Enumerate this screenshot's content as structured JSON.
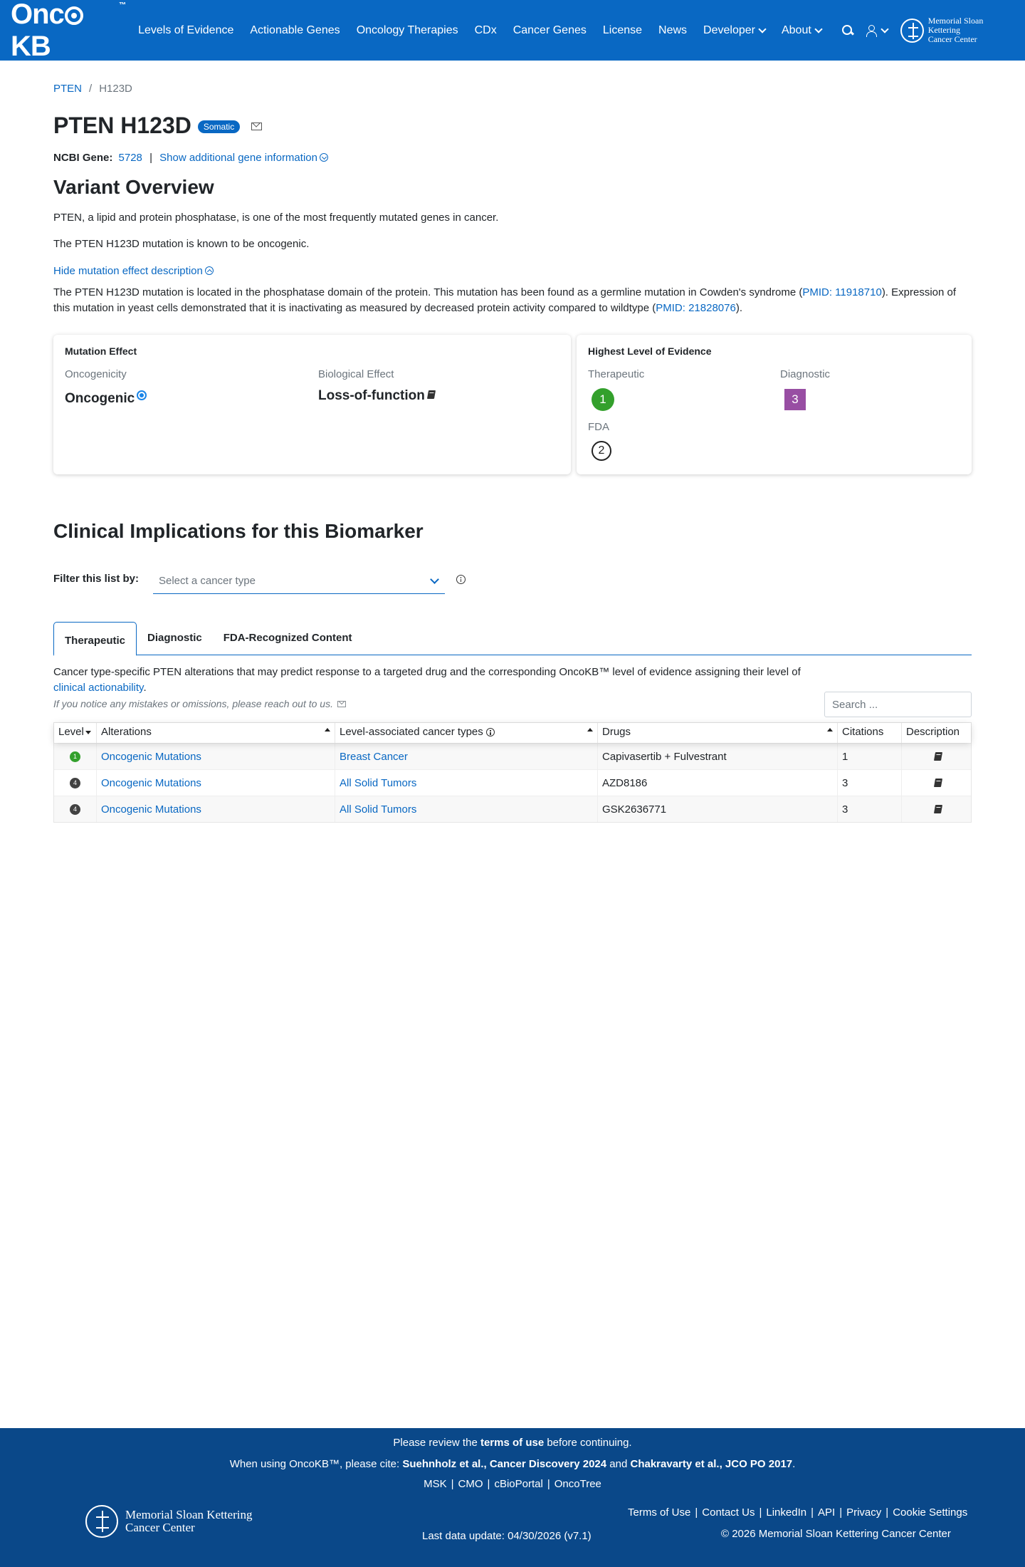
{
  "nav": {
    "logo": {
      "pre": "Onc",
      "post": "KB",
      "tm": "™"
    },
    "items": [
      "Levels of Evidence",
      "Actionable Genes",
      "Oncology Therapies",
      "CDx",
      "Cancer Genes",
      "License",
      "News",
      "Developer",
      "About"
    ],
    "msk_line1": "Memorial Sloan Kettering",
    "msk_line2": "Cancer Center"
  },
  "breadcrumb": {
    "gene": "PTEN",
    "sep": "/",
    "variant": "H123D"
  },
  "header": {
    "title": "PTEN H123D",
    "badge": "Somatic"
  },
  "ncbi": {
    "label": "NCBI Gene:",
    "id": "5728",
    "sep": "|",
    "more": "Show additional gene information"
  },
  "overview": {
    "heading": "Variant Overview",
    "p1": "PTEN, a lipid and protein phosphatase, is one of the most frequently mutated genes in cancer.",
    "p2": "The PTEN H123D mutation is known to be oncogenic.",
    "toggle": "Hide mutation effect description",
    "desc_a": "The PTEN H123D mutation is located in the phosphatase domain of the protein. This mutation has been found as a germline mutation in Cowden's syndrome (",
    "pmid1": "PMID: 11918710",
    "desc_b": "). Expression of this mutation in yeast cells demonstrated that it is inactivating as measured by decreased protein activity compared to wildtype (",
    "pmid2": "PMID: 21828076",
    "desc_c": ")."
  },
  "mutation_effect": {
    "title": "Mutation Effect",
    "oncogenicity_label": "Oncogenicity",
    "oncogenicity": "Oncogenic",
    "bio_label": "Biological Effect",
    "bio": "Loss-of-function"
  },
  "highest_level": {
    "title": "Highest Level of Evidence",
    "therapeutic_label": "Therapeutic",
    "therapeutic": "1",
    "diagnostic_label": "Diagnostic",
    "diagnostic": "3",
    "fda_label": "FDA",
    "fda": "2"
  },
  "colors": {
    "level1": "#33a02c",
    "level4": "#424242",
    "dx3": "#984ea3",
    "brand": "#0968c3",
    "footer": "#0a4889"
  },
  "clinical": {
    "heading": "Clinical Implications for this Biomarker",
    "filter_label": "Filter this list by:",
    "filter_placeholder": "Select a cancer type"
  },
  "tabs": [
    "Therapeutic",
    "Diagnostic",
    "FDA-Recognized Content"
  ],
  "table_desc": {
    "text": "Cancer type-specific PTEN alterations that may predict response to a targeted drug and the corresponding OncoKB™ level of evidence assigning their level of ",
    "link": "clinical actionability",
    "end": ".",
    "note": "If you notice any mistakes or omissions, please reach out to us.",
    "search_placeholder": "Search ..."
  },
  "table": {
    "headers": [
      "Level",
      "Alterations",
      "Level-associated cancer types",
      "Drugs",
      "Citations",
      "Description"
    ],
    "rows": [
      {
        "level": "1",
        "alteration": "Oncogenic Mutations",
        "cancer": "Breast Cancer",
        "drugs": "Capivasertib + Fulvestrant",
        "citations": "1"
      },
      {
        "level": "4",
        "alteration": "Oncogenic Mutations",
        "cancer": "All Solid Tumors",
        "drugs": "AZD8186",
        "citations": "3"
      },
      {
        "level": "4",
        "alteration": "Oncogenic Mutations",
        "cancer": "All Solid Tumors",
        "drugs": "GSK2636771",
        "citations": "3"
      }
    ]
  },
  "footer": {
    "review_a": "Please review the ",
    "review_b": "terms of use",
    "review_c": " before continuing.",
    "cite_a": "When using OncoKB™, please cite: ",
    "cite_b": "Suehnholz et al., Cancer Discovery 2024",
    "cite_c": " and ",
    "cite_d": "Chakravarty et al., JCO PO 2017",
    "cite_e": ".",
    "links1": [
      "MSK",
      "CMO",
      "cBioPortal",
      "OncoTree"
    ],
    "links2": [
      "Terms of Use",
      "Contact Us",
      "LinkedIn",
      "API",
      "Privacy",
      "Cookie Settings"
    ],
    "update": "Last data update: 04/30/2026 (v7.1)",
    "copyright": "© 2026 Memorial Sloan Kettering Cancer Center",
    "msk_line1": "Memorial Sloan Kettering",
    "msk_line2": "Cancer Center"
  }
}
